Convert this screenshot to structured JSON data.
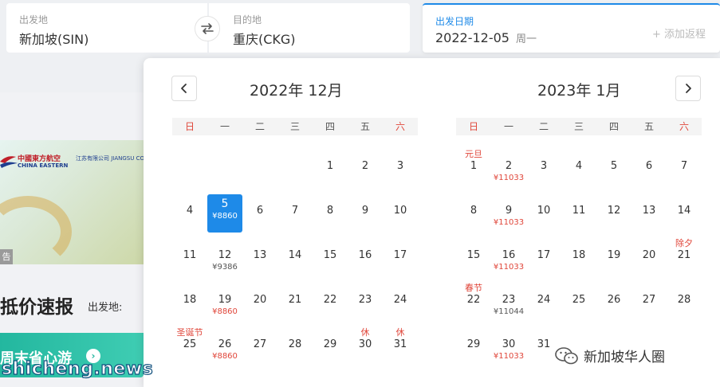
{
  "search": {
    "origin_label": "出发地",
    "origin_value": "新加坡(SIN)",
    "dest_label": "目的地",
    "dest_value": "重庆(CKG)",
    "date_label": "出发日期",
    "date_value": "2022-12-05",
    "date_weekday": "周一",
    "return_label": "+ 添加返程"
  },
  "background": {
    "ad_airline_cn": "中國東方航空",
    "ad_airline_en": "CHINA EASTERN",
    "ad_airline_sub": "江苏有限公司 JIANGSU CO.,LTD",
    "ad_tag": "告",
    "title": "抵价速报",
    "origin_label": "出发地:",
    "weekend_banner": "周末省心游",
    "watermark": "shicheng.news"
  },
  "calendar": {
    "weekdays": [
      "日",
      "一",
      "二",
      "三",
      "四",
      "五",
      "六"
    ],
    "month1": {
      "title": "2022年 12月",
      "days": [
        {},
        {},
        {},
        {},
        {
          "n": "1"
        },
        {
          "n": "2"
        },
        {
          "n": "3"
        },
        {
          "n": "4"
        },
        {
          "n": "5",
          "p": "¥8860",
          "sel": true
        },
        {
          "n": "6"
        },
        {
          "n": "7"
        },
        {
          "n": "8"
        },
        {
          "n": "9"
        },
        {
          "n": "10"
        },
        {
          "n": "11"
        },
        {
          "n": "12",
          "p": "¥9386"
        },
        {
          "n": "13"
        },
        {
          "n": "14"
        },
        {
          "n": "15"
        },
        {
          "n": "16"
        },
        {
          "n": "17"
        },
        {
          "n": "18"
        },
        {
          "n": "19",
          "p": "¥8860",
          "low": true
        },
        {
          "n": "20"
        },
        {
          "n": "21"
        },
        {
          "n": "22"
        },
        {
          "n": "23"
        },
        {
          "n": "24"
        },
        {
          "n": "25",
          "t": "圣诞节"
        },
        {
          "n": "26",
          "p": "¥8860",
          "low": true
        },
        {
          "n": "27"
        },
        {
          "n": "28"
        },
        {
          "n": "29"
        },
        {
          "n": "30",
          "t": "休"
        },
        {
          "n": "31",
          "t": "休"
        }
      ]
    },
    "month2": {
      "title": "2023年 1月",
      "days": [
        {
          "n": "1",
          "t": "元旦"
        },
        {
          "n": "2",
          "p": "¥11033",
          "low": true
        },
        {
          "n": "3"
        },
        {
          "n": "4"
        },
        {
          "n": "5"
        },
        {
          "n": "6"
        },
        {
          "n": "7"
        },
        {
          "n": "8"
        },
        {
          "n": "9",
          "p": "¥11033",
          "low": true
        },
        {
          "n": "10"
        },
        {
          "n": "11"
        },
        {
          "n": "12"
        },
        {
          "n": "13"
        },
        {
          "n": "14"
        },
        {
          "n": "15"
        },
        {
          "n": "16",
          "p": "¥11033",
          "low": true
        },
        {
          "n": "17"
        },
        {
          "n": "18"
        },
        {
          "n": "19"
        },
        {
          "n": "20"
        },
        {
          "n": "21",
          "t": "除夕"
        },
        {
          "n": "22",
          "t": "春节"
        },
        {
          "n": "23",
          "p": "¥11044"
        },
        {
          "n": "24"
        },
        {
          "n": "25"
        },
        {
          "n": "26"
        },
        {
          "n": "27"
        },
        {
          "n": "28"
        },
        {
          "n": "29"
        },
        {
          "n": "30",
          "p": "¥11033",
          "low": true
        },
        {
          "n": "31"
        }
      ]
    }
  },
  "watermark_right": "新加坡华人圈",
  "colors": {
    "accent": "#1e8ae8",
    "holiday_red": "#e0463a",
    "weekend_green": "#23b79f"
  },
  "icons": {
    "swap": "swap-arrows-icon",
    "prev": "chevron-left-icon",
    "next": "chevron-right-icon",
    "wechat": "wechat-icon"
  }
}
